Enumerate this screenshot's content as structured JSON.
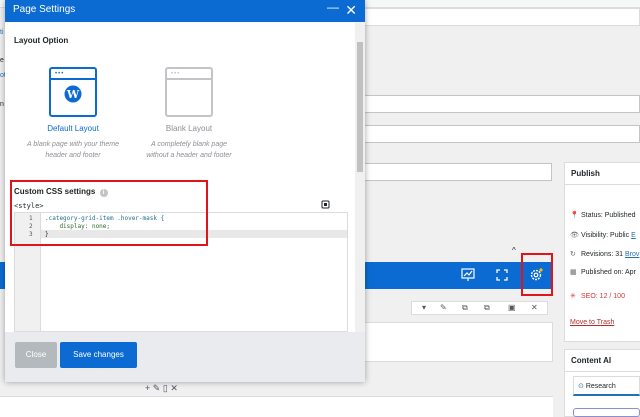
{
  "modal": {
    "title": "Page Settings",
    "minimize_glyph": "—",
    "close_glyph": "✕",
    "section_layout": "Layout Option",
    "layouts": [
      {
        "title": "Default Layout",
        "desc_line1": "A blank page with your theme",
        "desc_line2": "header and footer",
        "selected": true
      },
      {
        "title": "Blank Layout",
        "desc_line1": "A completely blank page",
        "desc_line2": "without a header and footer",
        "selected": false
      }
    ],
    "custom_css_label": "Custom CSS settings",
    "style_tag": "<style>",
    "code": {
      "line_numbers": [
        "1",
        "2",
        "3"
      ],
      "lines": [
        ".category-grid-item .hover-mask {",
        "    display: none;",
        "}"
      ]
    },
    "close_button": "Close",
    "save_button": "Save changes"
  },
  "edge_chars": [
    "ti",
    "e",
    "ot",
    "n"
  ],
  "publish": {
    "title": "Publish",
    "status": "Status: Published",
    "visibility_label": "Visibility: Public",
    "visibility_edit": "E",
    "revisions_label": "Revisions: 31",
    "revisions_link": "Brov",
    "published_on": "Published on: Apr",
    "seo": "SEO: 12 / 100",
    "trash": "Move to Trash"
  },
  "content_ai": {
    "title": "Content AI",
    "tab": "Research"
  },
  "icons": {
    "toolbar_chart": "chart-icon",
    "toolbar_expand": "expand-icon",
    "toolbar_settings": "gear-icon"
  },
  "colors": {
    "brand_blue": "#0b6bd2",
    "highlight_red": "#e0151b",
    "seo_red": "#d63638"
  }
}
